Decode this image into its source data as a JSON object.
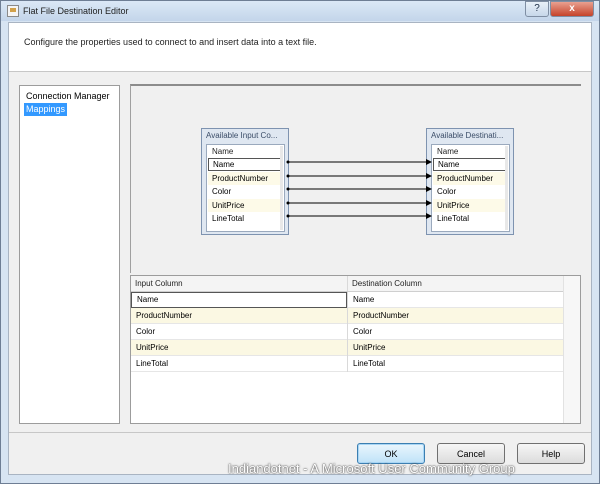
{
  "window": {
    "title": "Flat File Destination Editor",
    "help_glyph": "?",
    "close_glyph": "x"
  },
  "header": {
    "description": "Configure the properties used to connect to and insert data into a text file."
  },
  "nav": {
    "items": [
      {
        "label": "Connection Manager",
        "selected": false
      },
      {
        "label": "Mappings",
        "selected": true
      }
    ]
  },
  "diagram": {
    "input_box": {
      "title": "Available Input Co...",
      "header": "Name",
      "columns": [
        "Name",
        "ProductNumber",
        "Color",
        "UnitPrice",
        "LineTotal"
      ]
    },
    "destination_box": {
      "title": "Available Destinati...",
      "header": "Name",
      "columns": [
        "Name",
        "ProductNumber",
        "Color",
        "UnitPrice",
        "LineTotal"
      ]
    }
  },
  "grid": {
    "headers": [
      "Input Column",
      "Destination Column"
    ],
    "rows": [
      [
        "Name",
        "Name"
      ],
      [
        "ProductNumber",
        "ProductNumber"
      ],
      [
        "Color",
        "Color"
      ],
      [
        "UnitPrice",
        "UnitPrice"
      ],
      [
        "LineTotal",
        "LineTotal"
      ]
    ]
  },
  "buttons": {
    "ok": "OK",
    "cancel": "Cancel",
    "help": "Help"
  },
  "watermark": "Indiandotnet - A Microsoft User Community Group",
  "colors": {
    "selection": "#3399ff",
    "row_highlight": "#fbf8e3",
    "mapping_line": "#000000"
  }
}
